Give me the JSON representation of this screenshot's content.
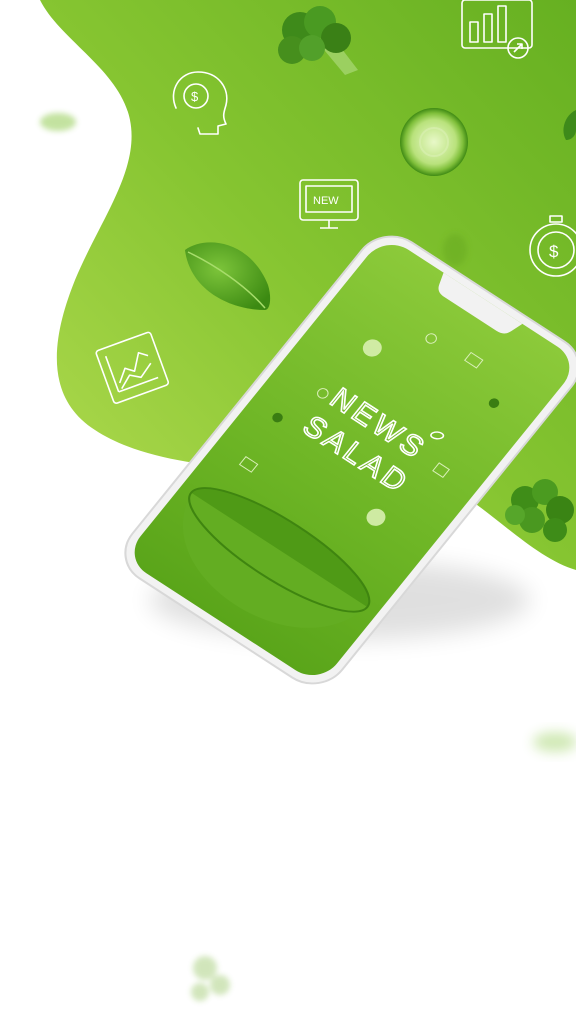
{
  "app": {
    "logo_line1": "NEWS",
    "logo_line2": "SALAD"
  },
  "icons": {
    "new_badge_label": "NEW"
  },
  "colors": {
    "brand_green_light": "#a8d84a",
    "brand_green": "#7cc12e",
    "brand_green_dark": "#4f9a12",
    "background": "#ffffff"
  }
}
